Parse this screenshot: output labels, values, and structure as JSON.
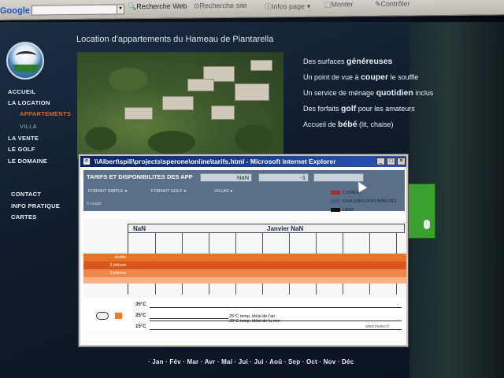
{
  "browser": {
    "search_brand": "Google",
    "items": [
      "Recherche Web",
      "Recherche site",
      "Infos page",
      "Monter",
      "Contrôler"
    ]
  },
  "site": {
    "title": "Location d'appartements du Hameau de Piantarella",
    "nav": [
      "ACCUEIL",
      "LA LOCATION",
      "APPARTEMENTS",
      "VILLA",
      "LA VENTE",
      "LE GOLF",
      "LE DOMAINE",
      "CONTACT",
      "INFO PRATIQUE",
      "CARTES"
    ],
    "features": [
      {
        "pre": "Des surfaces ",
        "bold": "généreuses",
        "post": ""
      },
      {
        "pre": "Un point de vue à ",
        "bold": "couper",
        "post": " le souffle"
      },
      {
        "pre": "Un service de ménage ",
        "bold": "quotidien",
        "post": " inclus"
      },
      {
        "pre": "Des forfaits ",
        "bold": "golf",
        "post": " pour les amateurs"
      },
      {
        "pre": "Accueil de ",
        "bold": "bébé",
        "post": " (lit, chaise)"
      }
    ]
  },
  "popup": {
    "window_title": "\\\\Albert\\spill\\projects\\sperone\\online\\tarifs.html - Microsoft Internet Explorer",
    "header_title": "TARIFS ET DISPONIBILITES DES APP",
    "field_left": "NaN",
    "field_mid": "-1",
    "tabs": [
      "FORFAIT SIMPLE",
      "FORFAIT GOLF",
      "VILLAS"
    ],
    "small_note": "6 couple",
    "legend": [
      {
        "label": "COMPLET",
        "color": "#b5262a"
      },
      {
        "label": "QUELQUES DISPONIBILITES",
        "color": "#4a5e8a"
      },
      {
        "label": "LIBRE",
        "color": "#111111"
      }
    ],
    "months": [
      "NaN",
      "Janvier NaN"
    ],
    "bands": [
      {
        "label": "studio",
        "color": "#e8742a"
      },
      {
        "label": "2 pièces",
        "color": "#d9561e"
      },
      {
        "label": "3 pièces",
        "color": "#f0874a"
      }
    ],
    "temps": [
      "35°C",
      "25°C",
      "15°C"
    ],
    "notes": [
      "25°C temp. idéal de l'air",
      "20°C temp. idéal de la mer"
    ],
    "credit": "www.meteo.fr",
    "months_bottom": "· Jan · Fév · Mar · Avr · Mai · Jui · Jui · Aoû · Sep · Oct · Nov · Déc"
  }
}
